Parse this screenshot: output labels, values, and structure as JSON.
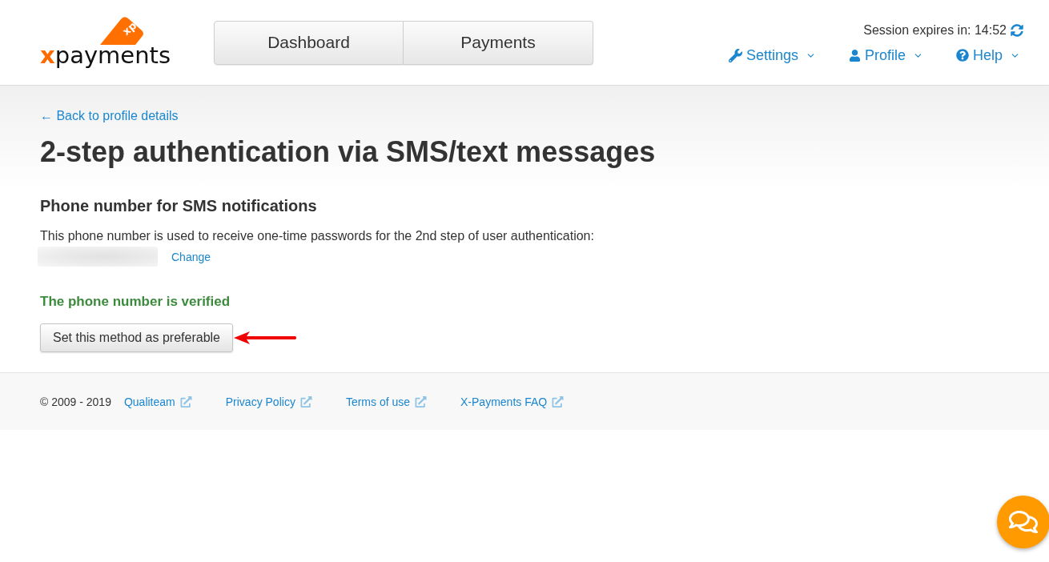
{
  "header": {
    "logo": {
      "tag": "xp",
      "wordmark_accent": "x",
      "wordmark_rest": "payments"
    },
    "tabs": [
      {
        "label": "Dashboard",
        "selected": false
      },
      {
        "label": "Payments",
        "selected": false
      }
    ],
    "session": "Session expires in: 14:52",
    "menu": [
      {
        "label": "Settings",
        "kind": "settings"
      },
      {
        "label": "Profile",
        "kind": "profile"
      },
      {
        "label": "Help",
        "kind": "help"
      }
    ]
  },
  "back_link": "← Back to profile details",
  "title": "2-step authentication via SMS/text messages",
  "phone_section": {
    "heading": "Phone number for SMS notifications",
    "description": "This phone number is used to receive one-time passwords for the 2nd step of user authentication:",
    "change_link": "Change",
    "status": "The phone number is verified",
    "button": "Set this method as preferable"
  },
  "footer": {
    "copyright": "© 2009 - 2019",
    "links": [
      "Qualiteam",
      "Privacy Policy",
      "Terms of use",
      "X-Payments FAQ"
    ]
  }
}
